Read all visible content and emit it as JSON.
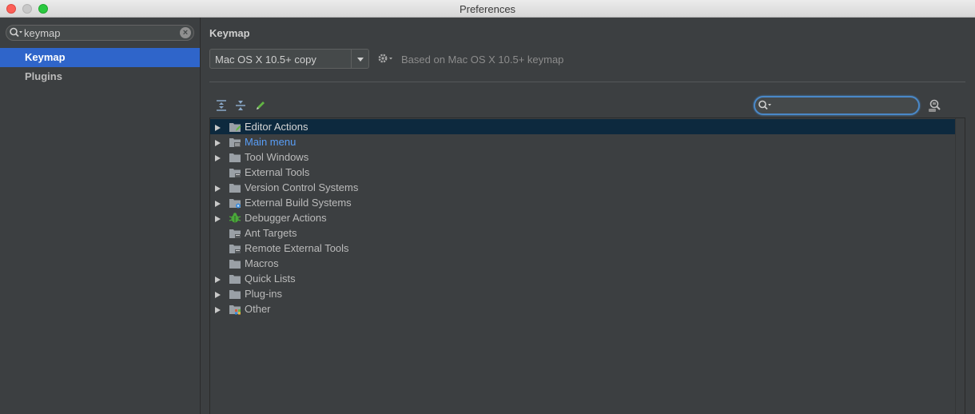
{
  "window": {
    "title": "Preferences"
  },
  "sidebar": {
    "search": {
      "value": "keymap",
      "placeholder": ""
    },
    "items": [
      {
        "label": "Keymap",
        "selected": true
      },
      {
        "label": "Plugins",
        "selected": false
      }
    ]
  },
  "main": {
    "heading": "Keymap",
    "keymap_select": {
      "value": "Mac OS X 10.5+ copy"
    },
    "based_on": "Based on Mac OS X 10.5+ keymap",
    "tree_search": {
      "value": ""
    },
    "tree": [
      {
        "label": "Editor Actions",
        "expandable": true,
        "icon": "editor-folder-icon",
        "selected": true,
        "link": false
      },
      {
        "label": "Main menu",
        "expandable": true,
        "icon": "menu-folder-icon",
        "selected": false,
        "link": true
      },
      {
        "label": "Tool Windows",
        "expandable": true,
        "icon": "folder-icon",
        "selected": false,
        "link": false
      },
      {
        "label": "External Tools",
        "expandable": false,
        "icon": "tools-folder-icon",
        "selected": false,
        "link": false
      },
      {
        "label": "Version Control Systems",
        "expandable": true,
        "icon": "folder-icon",
        "selected": false,
        "link": false
      },
      {
        "label": "External Build Systems",
        "expandable": true,
        "icon": "build-folder-icon",
        "selected": false,
        "link": false
      },
      {
        "label": "Debugger Actions",
        "expandable": true,
        "icon": "bug-icon",
        "selected": false,
        "link": false
      },
      {
        "label": "Ant Targets",
        "expandable": false,
        "icon": "tools-folder-icon",
        "selected": false,
        "link": false
      },
      {
        "label": "Remote External Tools",
        "expandable": false,
        "icon": "tools-folder-icon",
        "selected": false,
        "link": false
      },
      {
        "label": "Macros",
        "expandable": false,
        "icon": "folder-icon",
        "selected": false,
        "link": false
      },
      {
        "label": "Quick Lists",
        "expandable": true,
        "icon": "folder-icon",
        "selected": false,
        "link": false
      },
      {
        "label": "Plug-ins",
        "expandable": true,
        "icon": "folder-icon",
        "selected": false,
        "link": false
      },
      {
        "label": "Other",
        "expandable": true,
        "icon": "other-folder-icon",
        "selected": false,
        "link": false
      }
    ]
  },
  "colors": {
    "background": "#3c3f41",
    "selection": "#2f65ca",
    "tree_selection": "#0d293e",
    "link": "#589df6",
    "focus_ring": "#4a88c7"
  }
}
